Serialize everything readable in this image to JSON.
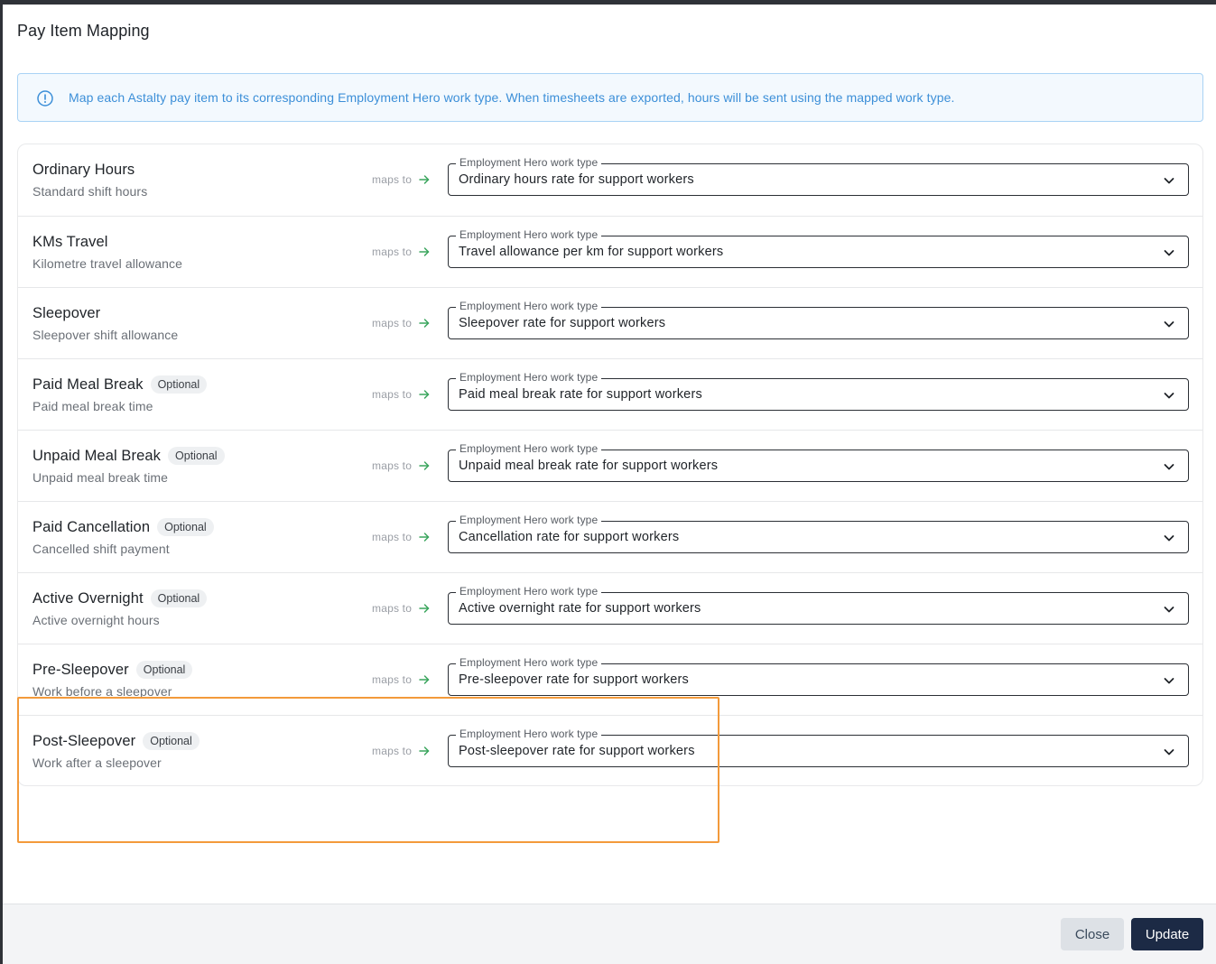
{
  "dialog": {
    "title": "Pay Item Mapping",
    "info_text": "Map each Astalty pay item to its corresponding Employment Hero work type. When timesheets are exported, hours will be sent using the mapped work type.",
    "maps_to_label": "maps to",
    "field_label": "Employment Hero work type",
    "optional_label": "Optional"
  },
  "rows": [
    {
      "title": "Ordinary Hours",
      "subtitle": "Standard shift hours",
      "optional": false,
      "value": "Ordinary hours rate for support workers"
    },
    {
      "title": "KMs Travel",
      "subtitle": "Kilometre travel allowance",
      "optional": false,
      "value": "Travel allowance per km for support workers"
    },
    {
      "title": "Sleepover",
      "subtitle": "Sleepover shift allowance",
      "optional": false,
      "value": "Sleepover rate for support workers"
    },
    {
      "title": "Paid Meal Break",
      "subtitle": "Paid meal break time",
      "optional": true,
      "value": "Paid meal break rate for support workers"
    },
    {
      "title": "Unpaid Meal Break",
      "subtitle": "Unpaid meal break time",
      "optional": true,
      "value": "Unpaid meal break rate for support workers"
    },
    {
      "title": "Paid Cancellation",
      "subtitle": "Cancelled shift payment",
      "optional": true,
      "value": "Cancellation rate for support workers"
    },
    {
      "title": "Active Overnight",
      "subtitle": "Active overnight hours",
      "optional": true,
      "value": "Active overnight rate for support workers"
    },
    {
      "title": "Pre-Sleepover",
      "subtitle": "Work before a sleepover",
      "optional": true,
      "value": "Pre-sleepover rate for support workers"
    },
    {
      "title": "Post-Sleepover",
      "subtitle": "Work after a sleepover",
      "optional": true,
      "value": "Post-sleepover rate for support workers"
    }
  ],
  "footer": {
    "close_label": "Close",
    "update_label": "Update"
  },
  "colors": {
    "primary": "#1c2a45",
    "info_blue": "#3c8fd8",
    "arrow_green": "#3aa55d",
    "highlight_orange": "#f39a3b"
  },
  "icons": {
    "info": "info-circle-icon",
    "arrow": "arrow-right-icon",
    "chevron": "chevron-down-icon"
  }
}
